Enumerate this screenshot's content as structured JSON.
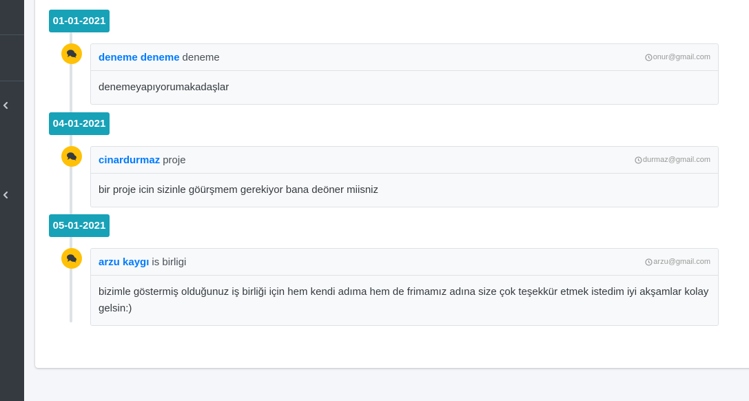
{
  "timeline": [
    {
      "date": "01-01-2021",
      "author": "deneme deneme",
      "subject": "deneme",
      "email": "onur@gmail.com",
      "message": "denemeyapıyorumakadaşlar"
    },
    {
      "date": "04-01-2021",
      "author": "cinardurmaz",
      "subject": "proje",
      "email": "durmaz@gmail.com",
      "message": "bir proje icin sizinle göürşmem gerekiyor bana deöner miisniz"
    },
    {
      "date": "05-01-2021",
      "author": "arzu kaygı",
      "subject": "is birligi",
      "email": "arzu@gmail.com",
      "message": "bizimle göstermiş olduğunuz iş birliği için hem kendi adıma hem de frimamız adına size çok teşekkür etmek istedim iyi akşamlar kolay gelsin:)"
    }
  ],
  "icons": {
    "sidebar_chevron": "chevron-left-icon",
    "item_icon": "comments-icon",
    "time_icon": "clock-icon"
  },
  "colors": {
    "sidebar": "#343a40",
    "time_label": "#17a2b8",
    "icon_bg": "#ffc107",
    "author_link": "#007bff"
  }
}
